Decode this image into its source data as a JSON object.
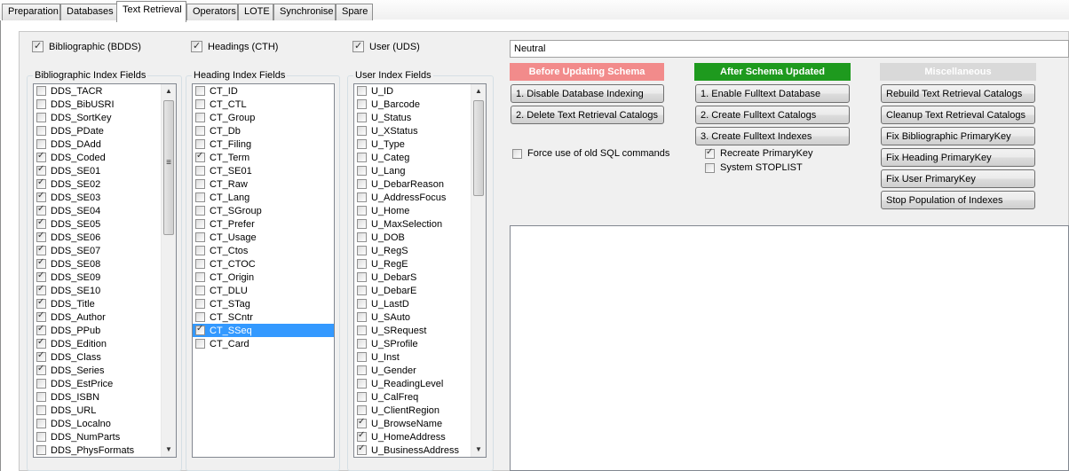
{
  "tabs": [
    "Preparation",
    "Databases",
    "Text Retrieval",
    "Operators",
    "LOTE",
    "Synchronise",
    "Spare"
  ],
  "active_tab": "Text Retrieval",
  "top_checks": {
    "bib": {
      "label": "Bibliographic (BDDS)",
      "checked": true
    },
    "heading": {
      "label": "Headings (CTH)",
      "checked": true
    },
    "user": {
      "label": "User (UDS)",
      "checked": true
    }
  },
  "bib_list": {
    "title": "Bibliographic Index Fields",
    "items": [
      {
        "label": "DDS_TACR",
        "checked": false
      },
      {
        "label": "DDS_BibUSRI",
        "checked": false
      },
      {
        "label": "DDS_SortKey",
        "checked": false
      },
      {
        "label": "DDS_PDate",
        "checked": false
      },
      {
        "label": "DDS_DAdd",
        "checked": false
      },
      {
        "label": "DDS_Coded",
        "checked": true
      },
      {
        "label": "DDS_SE01",
        "checked": true
      },
      {
        "label": "DDS_SE02",
        "checked": true
      },
      {
        "label": "DDS_SE03",
        "checked": true
      },
      {
        "label": "DDS_SE04",
        "checked": true
      },
      {
        "label": "DDS_SE05",
        "checked": true
      },
      {
        "label": "DDS_SE06",
        "checked": true
      },
      {
        "label": "DDS_SE07",
        "checked": true
      },
      {
        "label": "DDS_SE08",
        "checked": true
      },
      {
        "label": "DDS_SE09",
        "checked": true
      },
      {
        "label": "DDS_SE10",
        "checked": true
      },
      {
        "label": "DDS_Title",
        "checked": true
      },
      {
        "label": "DDS_Author",
        "checked": true
      },
      {
        "label": "DDS_PPub",
        "checked": true
      },
      {
        "label": "DDS_Edition",
        "checked": true
      },
      {
        "label": "DDS_Class",
        "checked": true
      },
      {
        "label": "DDS_Series",
        "checked": true
      },
      {
        "label": "DDS_EstPrice",
        "checked": false
      },
      {
        "label": "DDS_ISBN",
        "checked": false
      },
      {
        "label": "DDS_URL",
        "checked": false
      },
      {
        "label": "DDS_Localno",
        "checked": false
      },
      {
        "label": "DDS_NumParts",
        "checked": false
      },
      {
        "label": "DDS_PhysFormats",
        "checked": false
      }
    ]
  },
  "heading_list": {
    "title": "Heading Index Fields",
    "items": [
      {
        "label": "CT_ID",
        "checked": false
      },
      {
        "label": "CT_CTL",
        "checked": false
      },
      {
        "label": "CT_Group",
        "checked": false
      },
      {
        "label": "CT_Db",
        "checked": false
      },
      {
        "label": "CT_Filing",
        "checked": false
      },
      {
        "label": "CT_Term",
        "checked": true
      },
      {
        "label": "CT_SE01",
        "checked": false
      },
      {
        "label": "CT_Raw",
        "checked": false
      },
      {
        "label": "CT_Lang",
        "checked": false
      },
      {
        "label": "CT_SGroup",
        "checked": false
      },
      {
        "label": "CT_Prefer",
        "checked": false
      },
      {
        "label": "CT_Usage",
        "checked": false
      },
      {
        "label": "CT_Ctos",
        "checked": false
      },
      {
        "label": "CT_CTOC",
        "checked": false
      },
      {
        "label": "CT_Origin",
        "checked": false
      },
      {
        "label": "CT_DLU",
        "checked": false
      },
      {
        "label": "CT_STag",
        "checked": false
      },
      {
        "label": "CT_SCntr",
        "checked": false
      },
      {
        "label": "CT_SSeq",
        "checked": true,
        "selected": true
      },
      {
        "label": "CT_Card",
        "checked": false
      }
    ]
  },
  "user_list": {
    "title": "User Index Fields",
    "items": [
      {
        "label": "U_ID",
        "checked": false
      },
      {
        "label": "U_Barcode",
        "checked": false
      },
      {
        "label": "U_Status",
        "checked": false
      },
      {
        "label": "U_XStatus",
        "checked": false
      },
      {
        "label": "U_Type",
        "checked": false
      },
      {
        "label": "U_Categ",
        "checked": false
      },
      {
        "label": "U_Lang",
        "checked": false
      },
      {
        "label": "U_DebarReason",
        "checked": false
      },
      {
        "label": "U_AddressFocus",
        "checked": false
      },
      {
        "label": "U_Home",
        "checked": false
      },
      {
        "label": "U_MaxSelection",
        "checked": false
      },
      {
        "label": "U_DOB",
        "checked": false
      },
      {
        "label": "U_RegS",
        "checked": false
      },
      {
        "label": "U_RegE",
        "checked": false
      },
      {
        "label": "U_DebarS",
        "checked": false
      },
      {
        "label": "U_DebarE",
        "checked": false
      },
      {
        "label": "U_LastD",
        "checked": false
      },
      {
        "label": "U_SAuto",
        "checked": false
      },
      {
        "label": "U_SRequest",
        "checked": false
      },
      {
        "label": "U_SProfile",
        "checked": false
      },
      {
        "label": "U_Inst",
        "checked": false
      },
      {
        "label": "U_Gender",
        "checked": false
      },
      {
        "label": "U_ReadingLevel",
        "checked": false
      },
      {
        "label": "U_CalFreq",
        "checked": false
      },
      {
        "label": "U_ClientRegion",
        "checked": false
      },
      {
        "label": "U_BrowseName",
        "checked": true
      },
      {
        "label": "U_HomeAddress",
        "checked": true
      },
      {
        "label": "U_BusinessAddress",
        "checked": true
      }
    ]
  },
  "combo": {
    "value": "Neutral"
  },
  "before": {
    "title": "Before Updating Schema",
    "color": "#f28b8b",
    "buttons": [
      "1. Disable Database Indexing",
      "2. Delete Text Retrieval Catalogs"
    ],
    "force_label": "Force use of old SQL commands",
    "force_checked": false
  },
  "after": {
    "title": "After Schema Updated",
    "color": "#1e9a1e",
    "buttons": [
      "1. Enable Fulltext Database",
      "2. Create Fulltext Catalogs",
      "3. Create Fulltext Indexes"
    ],
    "recreate_label": "Recreate PrimaryKey",
    "recreate_checked": true,
    "stoplist_label": "System STOPLIST",
    "stoplist_checked": false
  },
  "misc": {
    "title": "Miscellaneous",
    "color": "#d9d9d9",
    "buttons": [
      "Rebuild Text Retrieval Catalogs",
      "Cleanup Text Retrieval Catalogs",
      "Fix Bibliographic PrimaryKey",
      "Fix Heading PrimaryKey",
      "Fix User PrimaryKey",
      "Stop Population of Indexes"
    ]
  }
}
